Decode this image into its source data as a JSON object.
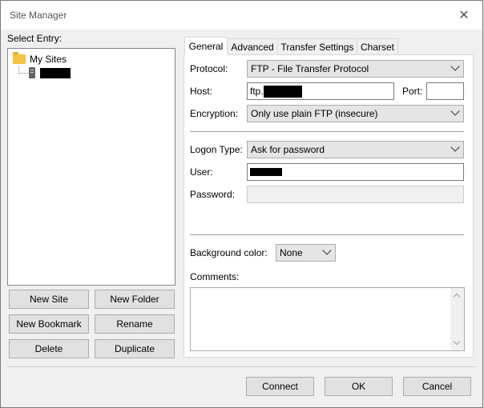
{
  "window": {
    "title": "Site Manager"
  },
  "left": {
    "select_entry_label": "Select Entry:",
    "tree_root": "My Sites",
    "buttons": {
      "new_site": "New Site",
      "new_folder": "New Folder",
      "new_bookmark": "New Bookmark",
      "rename": "Rename",
      "delete": "Delete",
      "duplicate": "Duplicate"
    }
  },
  "tabs": [
    "General",
    "Advanced",
    "Transfer Settings",
    "Charset"
  ],
  "general": {
    "protocol_label": "Protocol:",
    "protocol_value": "FTP - File Transfer Protocol",
    "host_label": "Host:",
    "host_value": "ftp.",
    "port_label": "Port:",
    "port_value": "",
    "encryption_label": "Encryption:",
    "encryption_value": "Only use plain FTP (insecure)",
    "logon_type_label": "Logon Type:",
    "logon_type_value": "Ask for password",
    "user_label": "User:",
    "password_label": "Password:",
    "bg_color_label": "Background color:",
    "bg_color_value": "None",
    "comments_label": "Comments:"
  },
  "footer": {
    "connect": "Connect",
    "ok": "OK",
    "cancel": "Cancel"
  },
  "icons": [
    "close-icon",
    "folder-icon",
    "server-icon",
    "chevron-down-icon",
    "scroll-up-icon",
    "scroll-down-icon"
  ]
}
